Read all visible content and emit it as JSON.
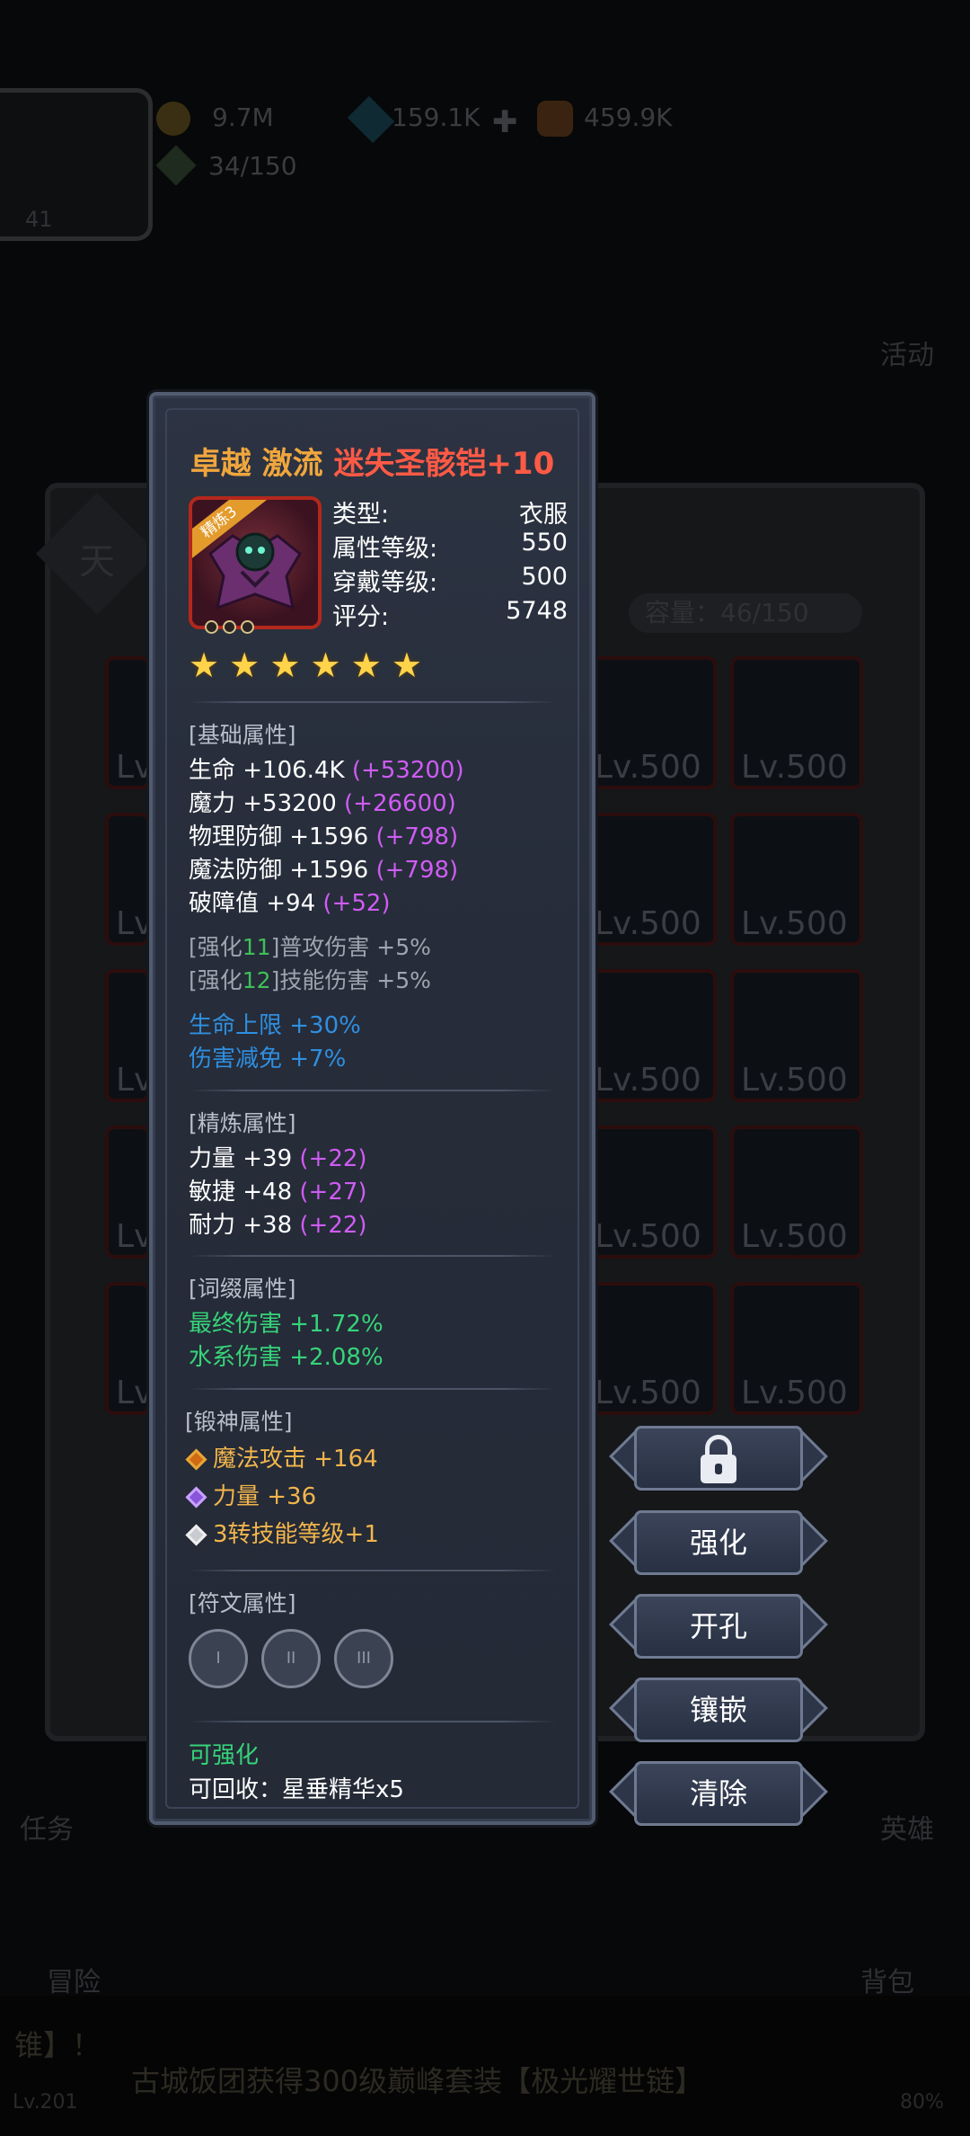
{
  "background": {
    "resources": {
      "gold": "9.7M",
      "gems": "159.1K",
      "potions": "459.9K",
      "energy": "34/150"
    },
    "player_level": "41",
    "activity_label": "活动",
    "calendar_char": "天",
    "capacity": "容量：46/150",
    "slot_levels": [
      "Lv.500",
      "Lv.500",
      "Lv.500",
      "Lv.500",
      "Lv.500",
      "Lv.500",
      "Lv.500",
      "Lv.500",
      "Lv.500",
      "Lv.500"
    ],
    "left_slot_text": "Lv",
    "nav": {
      "task": "任务",
      "hero": "英雄",
      "adventure": "冒险",
      "bag": "背包"
    },
    "news_line1": "锥】！",
    "news_line2": "古城饭团获得300级巅峰套装【极光耀世链】",
    "player_level_bottom": "Lv.201",
    "progress_text": "80%"
  },
  "item": {
    "title_quality": "卓越 激流",
    "title_name": "迷失圣骸铠+10",
    "badge": "精炼3",
    "type_label": "类型:",
    "type_value": "衣服",
    "attr_level_label": "属性等级:",
    "attr_level_value": "550",
    "wear_level_label": "穿戴等级:",
    "wear_level_value": "500",
    "score_label": "评分:",
    "score_value": "5748",
    "stars": 6,
    "star_glyph": "★",
    "sockets": 3
  },
  "base_attrs": {
    "header": "[基础属性]",
    "lines": [
      {
        "text": "生命 +106.4K ",
        "bonus": "(+53200)"
      },
      {
        "text": "魔力 +53200 ",
        "bonus": "(+26600)"
      },
      {
        "text": "物理防御 +1596 ",
        "bonus": "(+798)"
      },
      {
        "text": "魔法防御 +1596 ",
        "bonus": "(+798)"
      },
      {
        "text": "破障值 +94 ",
        "bonus": "(+52)"
      }
    ]
  },
  "enhance": {
    "lines": [
      {
        "pre": "[强化",
        "num": "11",
        "post": "]普攻伤害 +5%"
      },
      {
        "pre": "[强化",
        "num": "12",
        "post": "]技能伤害 +5%"
      }
    ],
    "extra": [
      "生命上限 +30%",
      "伤害减免 +7%"
    ]
  },
  "refine_attrs": {
    "header": "[精炼属性]",
    "lines": [
      {
        "text": "力量 +39 ",
        "bonus": "(+22)"
      },
      {
        "text": "敏捷 +48 ",
        "bonus": "(+27)"
      },
      {
        "text": "耐力 +38 ",
        "bonus": "(+22)"
      }
    ]
  },
  "affix_attrs": {
    "header": "[词缀属性]",
    "lines": [
      "最终伤害 +1.72%",
      "水系伤害 +2.08%"
    ]
  },
  "forge_attrs": {
    "header": "[锻神属性]",
    "lines": [
      "魔法攻击 +164",
      "力量 +36",
      "3转技能等级+1"
    ]
  },
  "rune_attrs": {
    "header": "[符文属性]",
    "slots": [
      "I",
      "II",
      "III"
    ]
  },
  "footer": {
    "can_enhance": "可强化",
    "recycle": "可回收：星垂精华x5"
  },
  "actions": {
    "enhance": "强化",
    "open_socket": "开孔",
    "inlay": "镶嵌",
    "clear": "清除"
  },
  "colors": {
    "quality_orange": "#f0a63d",
    "item_red": "#ff5a45",
    "bonus_purple": "#cf5cf4",
    "enhance_blue": "#2f8fe0",
    "affix_green": "#36d47a",
    "forge_gold": "#f2b54c"
  }
}
